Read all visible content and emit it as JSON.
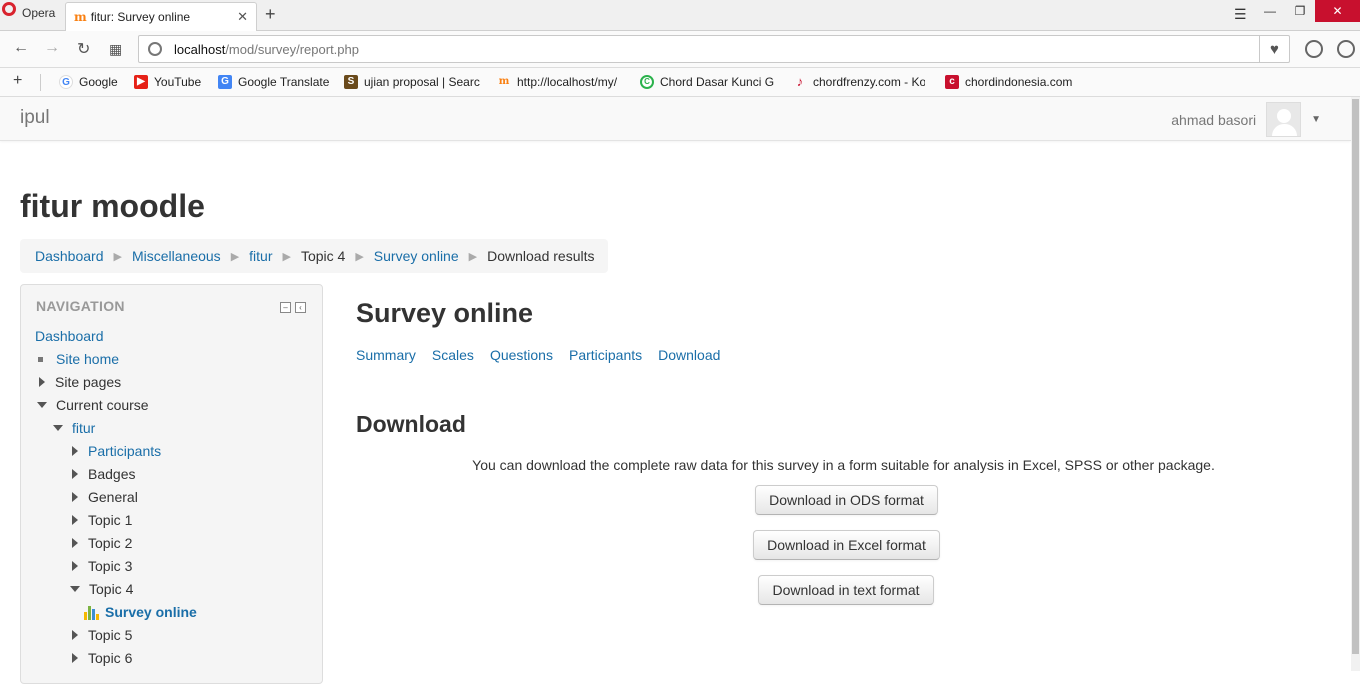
{
  "browser": {
    "app_label": "Opera",
    "tab_title": "fitur: Survey online",
    "url_host": "localhost",
    "url_path": "/mod/survey/report.php",
    "bookmarks": [
      {
        "label": "Google",
        "icon": "google-icon",
        "color": "#4285f4"
      },
      {
        "label": "YouTube",
        "icon": "youtube-icon",
        "color": "#e62117"
      },
      {
        "label": "Google Translate",
        "icon": "translate-icon",
        "color": "#4285f4"
      },
      {
        "label": "ujian proposal | Searc",
        "icon": "s-icon",
        "color": "#6a4a1b"
      },
      {
        "label": "http://localhost/my/",
        "icon": "moodle-icon",
        "color": "#f98012"
      },
      {
        "label": "Chord Dasar Kunci Gi",
        "icon": "c-circle-icon",
        "color": "#2bb24c"
      },
      {
        "label": "chordfrenzy.com - Ko",
        "icon": "guitar-icon",
        "color": "#c8102e"
      },
      {
        "label": "chordindonesia.com",
        "icon": "ci-icon",
        "color": "#c8102e"
      }
    ]
  },
  "navbar": {
    "brand": "ipul",
    "username": "ahmad basori"
  },
  "page": {
    "title": "fitur moodle",
    "breadcrumb": [
      {
        "label": "Dashboard",
        "link": true
      },
      {
        "label": "Miscellaneous",
        "link": true
      },
      {
        "label": "fitur",
        "link": true
      },
      {
        "label": "Topic 4",
        "link": false
      },
      {
        "label": "Survey online",
        "link": true
      },
      {
        "label": "Download results",
        "link": false
      }
    ]
  },
  "navigation": {
    "header": "NAVIGATION",
    "items": [
      {
        "label": "Dashboard",
        "link": true,
        "marker": "none"
      },
      {
        "label": "Site home",
        "link": true,
        "marker": "bullet"
      },
      {
        "label": "Site pages",
        "link": false,
        "marker": "right"
      },
      {
        "label": "Current course",
        "link": false,
        "marker": "down"
      },
      {
        "label": "fitur",
        "link": true,
        "marker": "down"
      },
      {
        "label": "Participants",
        "link": true,
        "marker": "right"
      },
      {
        "label": "Badges",
        "link": false,
        "marker": "right"
      },
      {
        "label": "General",
        "link": false,
        "marker": "right"
      },
      {
        "label": "Topic 1",
        "link": false,
        "marker": "right"
      },
      {
        "label": "Topic 2",
        "link": false,
        "marker": "right"
      },
      {
        "label": "Topic 3",
        "link": false,
        "marker": "right"
      },
      {
        "label": "Topic 4",
        "link": false,
        "marker": "down"
      },
      {
        "label": "Survey online",
        "link": true,
        "marker": "survey",
        "active": true
      },
      {
        "label": "Topic 5",
        "link": false,
        "marker": "right"
      },
      {
        "label": "Topic 6",
        "link": false,
        "marker": "right"
      }
    ]
  },
  "main": {
    "heading": "Survey online",
    "tabs": [
      "Summary",
      "Scales",
      "Questions",
      "Participants",
      "Download"
    ],
    "section_heading": "Download",
    "description": "You can download the complete raw data for this survey in a form suitable for analysis in Excel, SPSS or other package.",
    "buttons": [
      "Download in ODS format",
      "Download in Excel format",
      "Download in text format"
    ]
  },
  "colors": {
    "link": "#1a6ea8",
    "opera_red": "#d9232e",
    "moodle_orange": "#f98012"
  }
}
